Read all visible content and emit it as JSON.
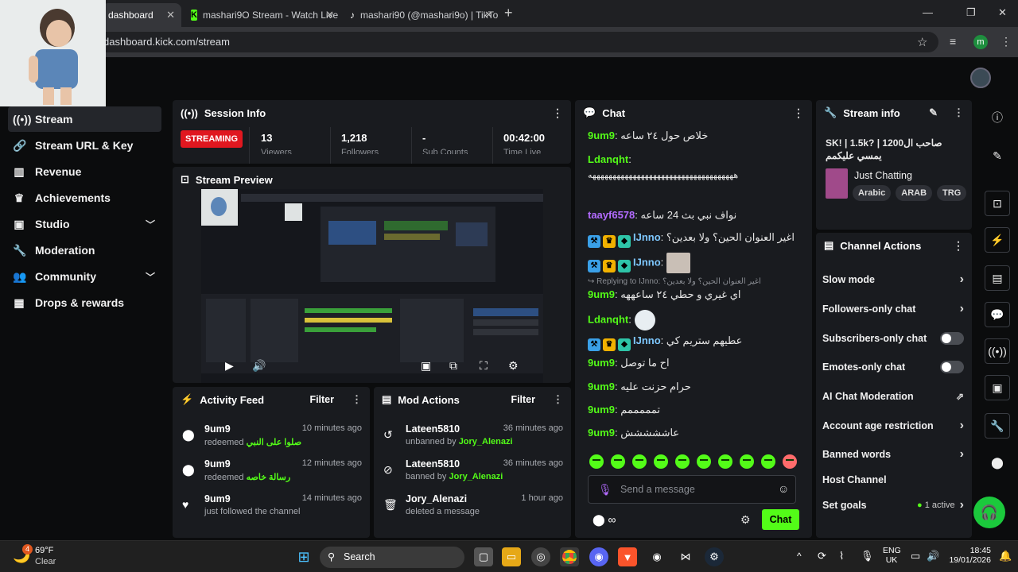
{
  "browser": {
    "tabs": [
      {
        "label": "dashboard",
        "icon": "kick-icon"
      },
      {
        "label": "mashari9O Stream - Watch Live",
        "icon": "kick-icon"
      },
      {
        "label": "mashari90 (@mashari9o) | TikTo",
        "icon": "tiktok-icon"
      }
    ],
    "new_tab": "+",
    "url": "dashboard.kick.com/stream",
    "profile_initial": "m"
  },
  "sidebar": {
    "items": [
      {
        "label": "Stream",
        "icon": "stream-icon"
      },
      {
        "label": "Stream URL & Key",
        "icon": "link-icon"
      },
      {
        "label": "Revenue",
        "icon": "revenue-icon"
      },
      {
        "label": "Achievements",
        "icon": "trophy-icon"
      },
      {
        "label": "Studio",
        "icon": "studio-icon"
      },
      {
        "label": "Moderation",
        "icon": "wrench-icon"
      },
      {
        "label": "Community",
        "icon": "community-icon"
      },
      {
        "label": "Drops & rewards",
        "icon": "gift-icon"
      }
    ]
  },
  "session": {
    "title": "Session Info",
    "status": "STREAMING",
    "stats": [
      {
        "value": "13",
        "label": "Viewers"
      },
      {
        "value": "1,218",
        "label": "Followers"
      },
      {
        "value": "-",
        "label": "Sub Counts"
      },
      {
        "value": "00:42:00",
        "label": "Time Live"
      }
    ]
  },
  "preview": {
    "title": "Stream Preview"
  },
  "activity": {
    "title": "Activity Feed",
    "filter": "Filter",
    "items": [
      {
        "user": "9um9",
        "action": "redeemed",
        "reward": "صلوا على النبي",
        "time": "10 minutes ago",
        "icon": "points-icon"
      },
      {
        "user": "9um9",
        "action": "redeemed",
        "reward": "رسالة خاصه",
        "time": "12 minutes ago",
        "icon": "points-icon"
      },
      {
        "user": "9um9",
        "action": "just followed the channel",
        "reward": "",
        "time": "14 minutes ago",
        "icon": "heart-icon"
      }
    ]
  },
  "mod_actions": {
    "title": "Mod Actions",
    "filter": "Filter",
    "items": [
      {
        "user": "Lateen5810",
        "action": "unbanned by",
        "by": "Jory_Alenazi",
        "time": "36 minutes ago",
        "icon": "undo-icon"
      },
      {
        "user": "Lateen5810",
        "action": "banned by",
        "by": "Jory_Alenazi",
        "time": "36 minutes ago",
        "icon": "ban-icon"
      },
      {
        "user": "Jory_Alenazi",
        "action": "deleted a message",
        "by": "",
        "time": "1 hour ago",
        "icon": "trash-icon"
      }
    ]
  },
  "chat": {
    "title": "Chat",
    "messages": [
      {
        "user": "9um9",
        "color": "#53fc18",
        "text": "خلاص حول ٢٤ ساعه"
      },
      {
        "user": "Ldanqht",
        "color": "#53fc18",
        "text": ""
      },
      {
        "user": "",
        "color": "#e6e6e6",
        "text": "ههههههههههههههههههههههههههههههههههههه"
      },
      {
        "user": "taayf6578",
        "color": "#b36bff",
        "text": "نواف نبي بث 24 ساعه"
      },
      {
        "user": "IJnno",
        "color": "#7ec8ff",
        "text": "اغير العنوان الحين؟ ولا بعدين؟"
      },
      {
        "user": "IJnno",
        "color": "#7ec8ff",
        "text": ""
      },
      {
        "user": "9um9",
        "color": "#53fc18",
        "text": "اي غيري و حطي ٢٤ ساعههه"
      },
      {
        "user": "Ldanqht",
        "color": "#53fc18",
        "text": ""
      },
      {
        "user": "IJnno",
        "color": "#7ec8ff",
        "text": "عطيهم ستريم كي"
      },
      {
        "user": "9um9",
        "color": "#53fc18",
        "text": "اح ما توصل"
      },
      {
        "user": "9um9",
        "color": "#53fc18",
        "text": "حرام حزنت عليه"
      },
      {
        "user": "9um9",
        "color": "#53fc18",
        "text": "تمممممم"
      },
      {
        "user": "9um9",
        "color": "#53fc18",
        "text": "عاششششش"
      }
    ],
    "reply_label": "Replying to IJnno:",
    "reply_text": "اغير العنوان الحين؟ ولا بعدين؟",
    "input_placeholder": "Send a message",
    "send_label": "Chat"
  },
  "stream_info": {
    "title": "Stream info",
    "stream_title": "SK! | 1.5k? | صاحب ال1200 يمسي عليكمم",
    "category": "Just Chatting",
    "tags": [
      "Arabic",
      "ARAB",
      "TRG"
    ]
  },
  "channel_actions": {
    "title": "Channel Actions",
    "rows": [
      {
        "label": "Slow mode",
        "kind": "arrow"
      },
      {
        "label": "Followers-only chat",
        "kind": "arrow"
      },
      {
        "label": "Subscribers-only chat",
        "kind": "toggle"
      },
      {
        "label": "Emotes-only chat",
        "kind": "toggle"
      },
      {
        "label": "AI Chat Moderation",
        "kind": "external"
      },
      {
        "label": "Account age restriction",
        "kind": "arrow"
      },
      {
        "label": "Banned words",
        "kind": "arrow"
      },
      {
        "label": "Host Channel",
        "kind": "none"
      },
      {
        "label": "Set goals",
        "kind": "arrow",
        "extra": "1 active"
      }
    ]
  },
  "taskbar": {
    "weather_temp": "69°F",
    "weather_desc": "Clear",
    "search": "Search",
    "lang1": "ENG",
    "lang2": "UK",
    "time": "18:45",
    "date": "19/01/2026",
    "weather_badge": "4"
  }
}
